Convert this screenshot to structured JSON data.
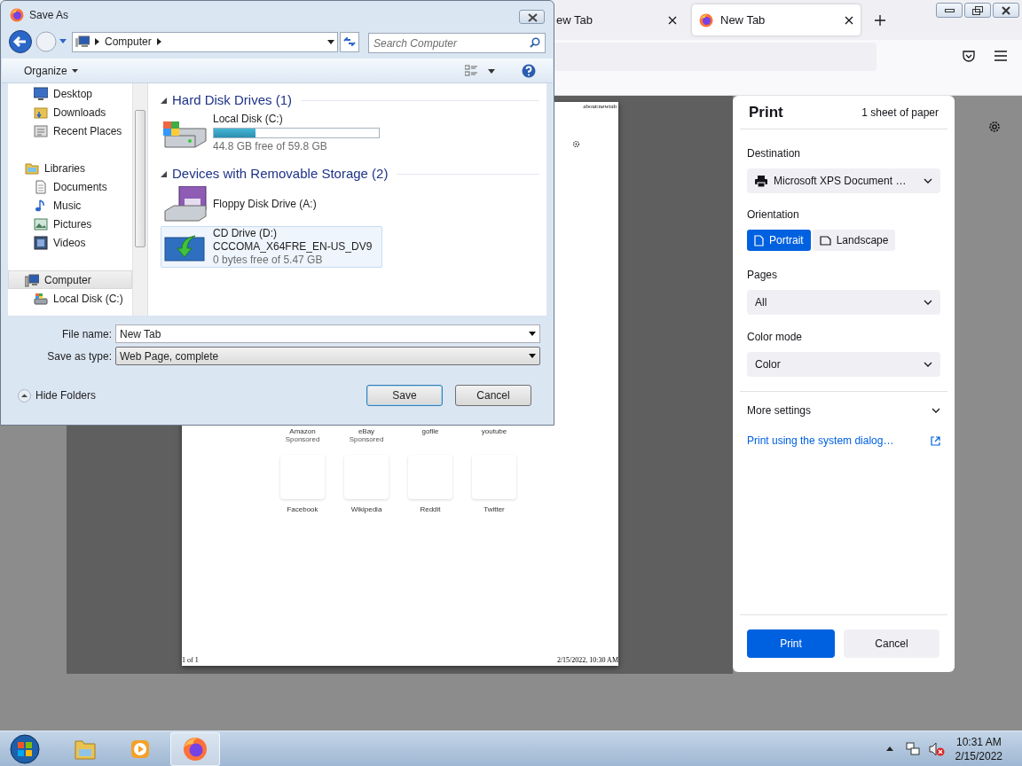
{
  "browser": {
    "tabs": [
      {
        "label": "ew Tab",
        "selected": false
      },
      {
        "label": "New Tab",
        "selected": true
      }
    ]
  },
  "print_preview": {
    "header_url": "about:newtab",
    "top_sites": [
      {
        "label": "Amazon",
        "sublabel": "Sponsored"
      },
      {
        "label": "eBay",
        "sublabel": "Sponsored"
      },
      {
        "label": "gofile"
      },
      {
        "label": "youtube"
      }
    ],
    "shortcuts": [
      {
        "label": "Facebook"
      },
      {
        "label": "Wikipedia"
      },
      {
        "label": "Reddit"
      },
      {
        "label": "Twitter"
      }
    ],
    "footer_left": "1 of 1",
    "footer_right": "2/15/2022, 10:30 AM"
  },
  "print_panel": {
    "title": "Print",
    "sheets": "1 sheet of paper",
    "destination": {
      "label": "Destination",
      "value": "Microsoft XPS Document …"
    },
    "orientation": {
      "label": "Orientation",
      "options": [
        {
          "label": "Portrait",
          "selected": true
        },
        {
          "label": "Landscape",
          "selected": false
        }
      ]
    },
    "pages": {
      "label": "Pages",
      "value": "All"
    },
    "color_mode": {
      "label": "Color mode",
      "value": "Color"
    },
    "more_settings": "More settings",
    "system_dialog_link": "Print using the system dialog…",
    "buttons": [
      {
        "label": "Print",
        "kind": "primary"
      },
      {
        "label": "Cancel",
        "kind": "secondary"
      }
    ]
  },
  "save_dialog": {
    "title": "Save As",
    "breadcrumb": [
      "Computer"
    ],
    "search": {
      "placeholder": "Search Computer"
    },
    "organize": "Organize",
    "nav": [
      {
        "children": [
          {
            "label": "Desktop",
            "selected": false
          },
          {
            "label": "Downloads",
            "selected": false
          },
          {
            "label": "Recent Places",
            "selected": false
          }
        ]
      },
      {
        "label": "Libraries",
        "selected": false,
        "children": [
          {
            "label": "Documents",
            "selected": false
          },
          {
            "label": "Music",
            "selected": false
          },
          {
            "label": "Pictures",
            "selected": false
          },
          {
            "label": "Videos",
            "selected": false
          }
        ]
      },
      {
        "label": "Computer",
        "selected": true,
        "children": [
          {
            "label": "Local Disk (C:)",
            "selected": false
          }
        ]
      }
    ],
    "groups": [
      {
        "title": "Hard Disk Drives (1)",
        "items": [
          {
            "name": "Local Disk (C:)",
            "level": 0.25,
            "detail": "44.8 GB free of 59.8 GB",
            "selected": false
          }
        ]
      },
      {
        "title": "Devices with Removable Storage (2)",
        "items": [
          {
            "name": "Floppy Disk Drive (A:)",
            "selected": false
          },
          {
            "name": "CD Drive (D:)",
            "label": "CCCOMA_X64FRE_EN-US_DV9",
            "detail": "0 bytes free of 5.47 GB",
            "selected": true
          }
        ]
      }
    ],
    "file_name": {
      "label": "File name:",
      "value": "New Tab"
    },
    "save_as_type": {
      "label": "Save as type:",
      "value": "Web Page, complete"
    },
    "hide_folders": "Hide Folders",
    "buttons": [
      {
        "label": "Save",
        "kind": "default"
      },
      {
        "label": "Cancel",
        "kind": "normal"
      }
    ]
  },
  "taskbar": {
    "apps": [
      {
        "selected": false
      },
      {
        "selected": false
      },
      {
        "selected": true
      }
    ],
    "time": "10:31 AM",
    "date": "2/15/2022"
  }
}
